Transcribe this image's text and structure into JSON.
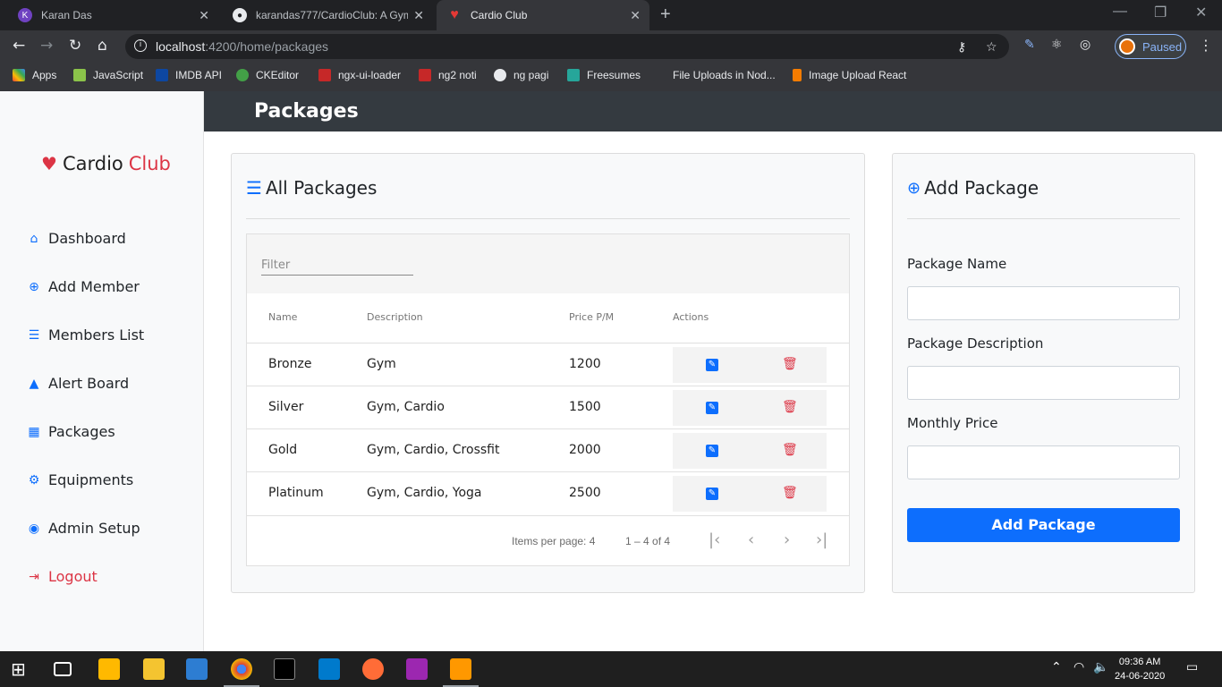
{
  "browser": {
    "tabs": [
      {
        "label": "Karan Das",
        "icon": "k-icon"
      },
      {
        "label": "karandas777/CardioClub: A Gym",
        "icon": "github-icon"
      },
      {
        "label": "Cardio Club",
        "icon": "heart-icon"
      }
    ],
    "url_host": "localhost",
    "url_path": ":4200/home/packages",
    "profile_status": "Paused",
    "bookmarks": [
      "Apps",
      "JavaScript",
      "IMDB API",
      "CKEditor",
      "ngx-ui-loader",
      "ng2 noti",
      "ng pagi",
      "Freesumes",
      "File Uploads in Nod...",
      "Image Upload React"
    ]
  },
  "sidebar": {
    "brand_main": "Cardio",
    "brand_accent": "Club",
    "items": [
      {
        "label": "Dashboard",
        "icon": "home-icon"
      },
      {
        "label": "Add Member",
        "icon": "plus-circle-icon"
      },
      {
        "label": "Members List",
        "icon": "list-icon"
      },
      {
        "label": "Alert Board",
        "icon": "warning-icon"
      },
      {
        "label": "Packages",
        "icon": "grid-icon"
      },
      {
        "label": "Equipments",
        "icon": "gear-icon"
      },
      {
        "label": "Admin Setup",
        "icon": "user-circle-icon"
      },
      {
        "label": "Logout",
        "icon": "sign-out-icon"
      }
    ]
  },
  "header": {
    "title": "Packages"
  },
  "packages_card": {
    "title": "All Packages",
    "filter_placeholder": "Filter",
    "columns": [
      "Name",
      "Description",
      "Price P/M",
      "Actions"
    ],
    "rows": [
      {
        "name": "Bronze",
        "description": "Gym",
        "price": "1200"
      },
      {
        "name": "Silver",
        "description": "Gym, Cardio",
        "price": "1500"
      },
      {
        "name": "Gold",
        "description": "Gym, Cardio, Crossfit",
        "price": "2000"
      },
      {
        "name": "Platinum",
        "description": "Gym, Cardio, Yoga",
        "price": "2500"
      }
    ],
    "paginator": {
      "items_per_page_label": "Items per page:",
      "items_per_page": "4",
      "range": "1 – 4 of 4"
    }
  },
  "add_card": {
    "title": "Add Package",
    "name_label": "Package Name",
    "description_label": "Package Description",
    "price_label": "Monthly Price",
    "submit_label": "Add Package"
  },
  "taskbar": {
    "time": "09:36 AM",
    "date": "24-06-2020"
  },
  "colors": {
    "primary": "#0d6efd",
    "danger": "#dc3545",
    "header_dark": "#343a40"
  }
}
